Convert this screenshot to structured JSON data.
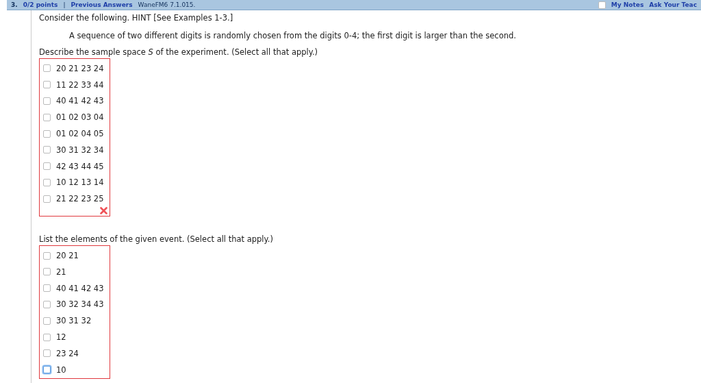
{
  "header": {
    "number": "3.",
    "points": "0/2 points",
    "separator": "|",
    "previous": "Previous Answers",
    "code": "WaneFM6 7.1.015.",
    "notes": "My Notes",
    "notes_checked": false,
    "ask": "Ask Your Teac"
  },
  "intro": "Consider the following. HINT [See Examples 1-3.]",
  "statement": "A sequence of two different digits is randomly chosen from the digits 0-4; the first digit is larger than the second.",
  "questions": [
    {
      "prompt": "Describe the sample space *S* of the experiment. (Select all that apply.)",
      "incorrect": true,
      "options": [
        {
          "label": "20 21 23 24",
          "checked": false,
          "focused": false
        },
        {
          "label": "11 22 33 44",
          "checked": false,
          "focused": false
        },
        {
          "label": "40 41 42 43",
          "checked": false,
          "focused": false
        },
        {
          "label": "01 02 03 04",
          "checked": false,
          "focused": false
        },
        {
          "label": "01 02 04 05",
          "checked": false,
          "focused": false
        },
        {
          "label": "30 31 32 34",
          "checked": false,
          "focused": false
        },
        {
          "label": "42 43 44 45",
          "checked": false,
          "focused": false
        },
        {
          "label": "10 12 13 14",
          "checked": false,
          "focused": false
        },
        {
          "label": "21 22 23 25",
          "checked": false,
          "focused": false
        }
      ]
    },
    {
      "prompt": "List the elements of the given event. (Select all that apply.)",
      "incorrect": false,
      "options": [
        {
          "label": "20 21",
          "checked": false,
          "focused": false
        },
        {
          "label": "21",
          "checked": false,
          "focused": false
        },
        {
          "label": "40 41 42 43",
          "checked": false,
          "focused": false
        },
        {
          "label": "30 32 34 43",
          "checked": false,
          "focused": false
        },
        {
          "label": "30 31 32",
          "checked": false,
          "focused": false
        },
        {
          "label": "12",
          "checked": false,
          "focused": false
        },
        {
          "label": "23 24",
          "checked": false,
          "focused": false
        },
        {
          "label": "10",
          "checked": false,
          "focused": true
        }
      ]
    }
  ]
}
